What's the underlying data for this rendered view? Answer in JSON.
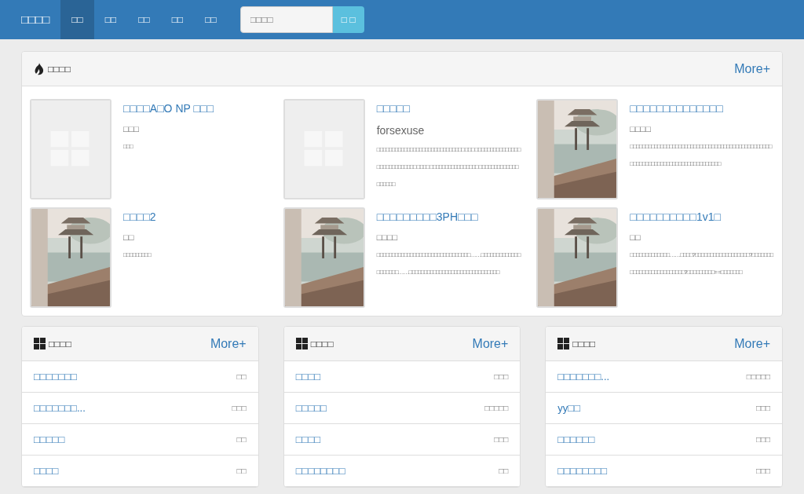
{
  "navbar": {
    "brand": "□□□□",
    "items": [
      {
        "label": "□□",
        "selected": true
      },
      {
        "label": "□□",
        "selected": false
      },
      {
        "label": "□□",
        "selected": false
      },
      {
        "label": "□□",
        "selected": false
      },
      {
        "label": "□□",
        "selected": false
      }
    ],
    "search": {
      "placeholder": "□□□□",
      "button": "□ □"
    }
  },
  "featured": {
    "title": "□□□□",
    "more": "More+",
    "books": [
      {
        "cover": {
          "kind": "picture",
          "blank": true
        },
        "title": "□□□□A□O NP □□□",
        "author": "□□□",
        "desc": "□□□"
      },
      {
        "cover": {
          "kind": "picture",
          "blank": true
        },
        "title": "□□□□□",
        "author": "forsexuse",
        "desc": "□□□□□□□□□□□□□□□□□□□□□□□□□□□□□ □□□ □□□□□□□□□□□□□□□□□□□□□□□□□□□□ □□□□ □□□□□□□□□□□□□□□□ □□□□□□□□□□□□□□□□□□□"
      },
      {
        "cover": {
          "kind": "picture",
          "blank": false
        },
        "title": "□□□□□□□□□□□□□□",
        "author": "□□□□",
        "desc": "□□□□□□□□□□□□□□□□□□□□□□□□□□□□□□□□□□□□□□□□□□□□□□□□□□□□□□□□□□□□□□□□□□□□□□□□□□□□□"
      },
      {
        "cover": {
          "kind": "picture",
          "blank": false
        },
        "title": "□□□□2",
        "author": "□□",
        "desc": "□□□□□□□□□"
      },
      {
        "cover": {
          "kind": "picture",
          "blank": false
        },
        "title": "□□□□□□□□□3PH□□□",
        "author": "□□□□",
        "desc": "□□□□□□□□□□□□□□□□□□□□□□□□□□□□□□□……□□□□□□□□□□□□□□□□□□□□……□□□□□□□□□□□□□□□□□□□□□□□□□□□□□□"
      },
      {
        "cover": {
          "kind": "picture",
          "blank": false
        },
        "title": "□□□□□□□□□□1v1□",
        "author": "□□",
        "desc": "□□□□□□□□□□□□□……□□□□?□□□□□□□□□□□□□□□□□□?□□□□□□□□□□□□□□□□□□□□□□□□□?□□□□□□□□□= =□□□□□□□"
      }
    ]
  },
  "lists": [
    {
      "title": "□□□□",
      "more": "More+",
      "rows": [
        {
          "name": "□□□□□□□",
          "author": "□□"
        },
        {
          "name": "□□□□□□□...",
          "author": "□□□"
        },
        {
          "name": "□□□□□",
          "author": "□□"
        },
        {
          "name": "□□□□",
          "author": "□□"
        }
      ]
    },
    {
      "title": "□□□□",
      "more": "More+",
      "rows": [
        {
          "name": "□□□□",
          "author": "□□□"
        },
        {
          "name": "□□□□□",
          "author": "□□□□□"
        },
        {
          "name": "□□□□",
          "author": "□□□"
        },
        {
          "name": "□□□□□□□□",
          "author": "□□"
        }
      ]
    },
    {
      "title": "□□□□",
      "more": "More+",
      "rows": [
        {
          "name": "□□□□□□□...",
          "author": "□□□□□"
        },
        {
          "name": "yy□□",
          "author": "□□□"
        },
        {
          "name": "□□□□□□",
          "author": "□□□"
        },
        {
          "name": "□□□□□□□□",
          "author": "□□□"
        }
      ]
    }
  ]
}
